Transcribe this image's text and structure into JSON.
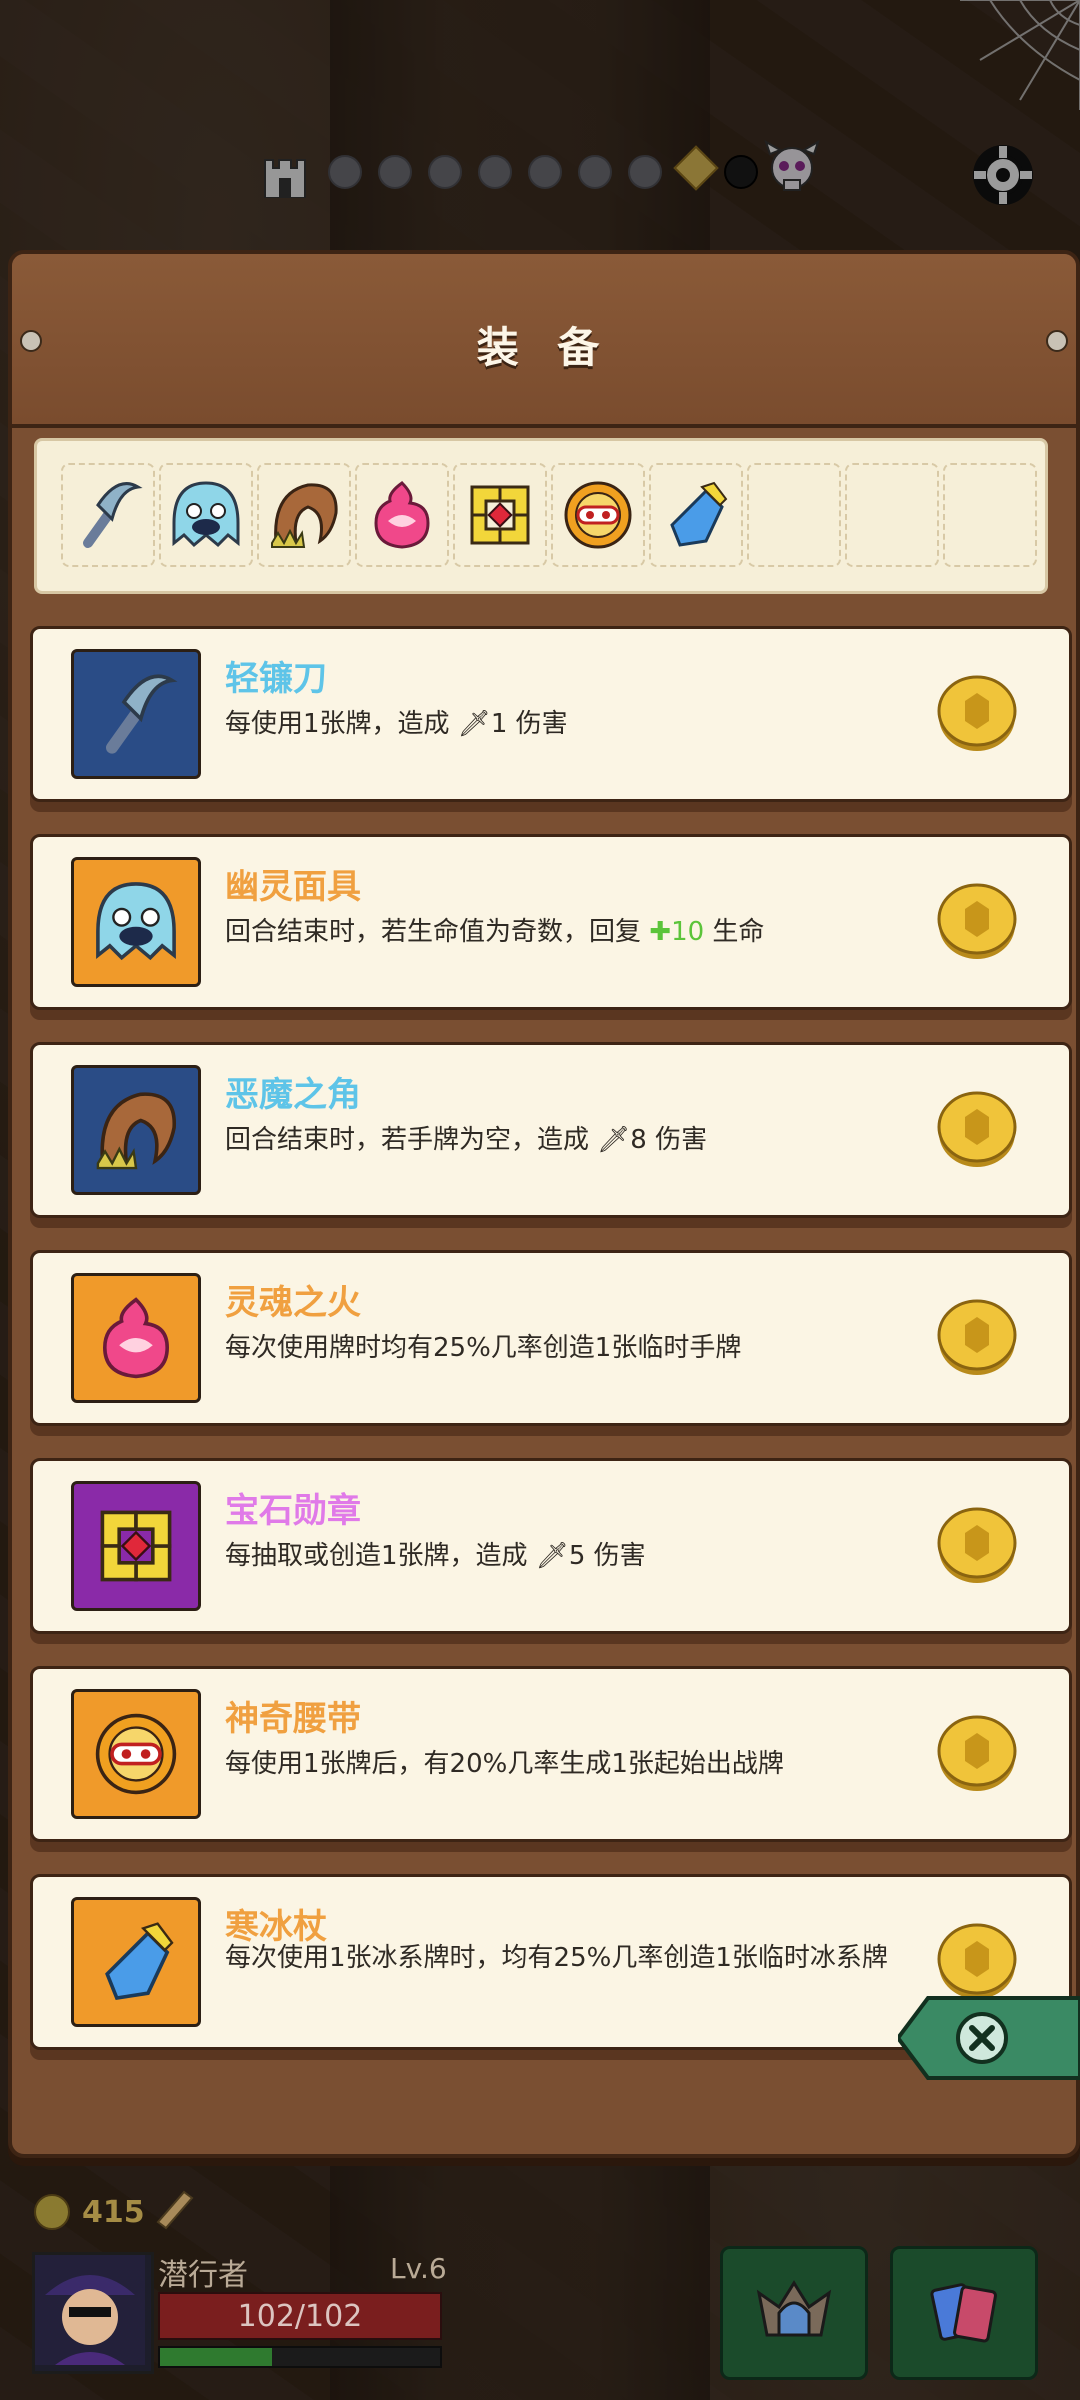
{
  "panel": {
    "title": "装 备"
  },
  "slots": [
    {
      "icon": "sickle-icon"
    },
    {
      "icon": "ghost-mask-icon"
    },
    {
      "icon": "demon-horn-icon"
    },
    {
      "icon": "soul-fire-icon"
    },
    {
      "icon": "gem-medal-icon"
    },
    {
      "icon": "magic-belt-icon"
    },
    {
      "icon": "ice-staff-icon"
    },
    {
      "icon": ""
    },
    {
      "icon": ""
    },
    {
      "icon": ""
    }
  ],
  "items": [
    {
      "name": "轻镰刀",
      "name_color": "#5ec4e8",
      "icon_bg": "#2a4c86",
      "icon": "sickle-icon",
      "desc_pre": "每使用1张牌，造成 ",
      "stat_icon": "sword-icon",
      "stat": "1",
      "stat_color": "#2f2a24",
      "desc_post": " 伤害"
    },
    {
      "name": "幽灵面具",
      "name_color": "#f0a040",
      "icon_bg": "#f09a2a",
      "icon": "ghost-mask-icon",
      "desc_pre": "回合结束时，若生命值为奇数，回复 ",
      "stat_icon": "heal-plus-icon",
      "stat": "10",
      "stat_color": "#5bc43a",
      "desc_post": " 生命"
    },
    {
      "name": "恶魔之角",
      "name_color": "#5ec4e8",
      "icon_bg": "#2a4c86",
      "icon": "demon-horn-icon",
      "desc_pre": "回合结束时，若手牌为空，造成 ",
      "stat_icon": "sword-icon",
      "stat": "8",
      "stat_color": "#2f2a24",
      "desc_post": " 伤害"
    },
    {
      "name": "灵魂之火",
      "name_color": "#f0a040",
      "icon_bg": "#f09a2a",
      "icon": "soul-fire-icon",
      "desc_pre": "每次使用牌时均有25%几率创造1张临时手牌",
      "stat_icon": "",
      "stat": "",
      "stat_color": "#2f2a24",
      "desc_post": ""
    },
    {
      "name": "宝石勋章",
      "name_color": "#e07ae8",
      "icon_bg": "#8a2aa8",
      "icon": "gem-medal-icon",
      "desc_pre": "每抽取或创造1张牌，造成 ",
      "stat_icon": "sword-icon",
      "stat": "5",
      "stat_color": "#2f2a24",
      "desc_post": " 伤害"
    },
    {
      "name": "神奇腰带",
      "name_color": "#f0a040",
      "icon_bg": "#f09a2a",
      "icon": "magic-belt-icon",
      "desc_pre": "每使用1张牌后，有20%几率生成1张起始出战牌",
      "stat_icon": "",
      "stat": "",
      "stat_color": "#2f2a24",
      "desc_post": ""
    },
    {
      "name": "寒冰杖",
      "name_color": "#f0a040",
      "icon_bg": "#f09a2a",
      "icon": "ice-staff-icon",
      "desc_pre": "每次使用1张冰系牌时，均有25%几率创造1张临时冰系牌",
      "stat_icon": "",
      "stat": "",
      "stat_color": "#2f2a24",
      "desc_post": ""
    }
  ],
  "hud": {
    "gold": "415",
    "player_name": "潜行者",
    "level": "Lv.6",
    "hp": "102/102",
    "xp_fraction": 0.4
  },
  "progress": {
    "dots": 7,
    "current_index": 7
  }
}
